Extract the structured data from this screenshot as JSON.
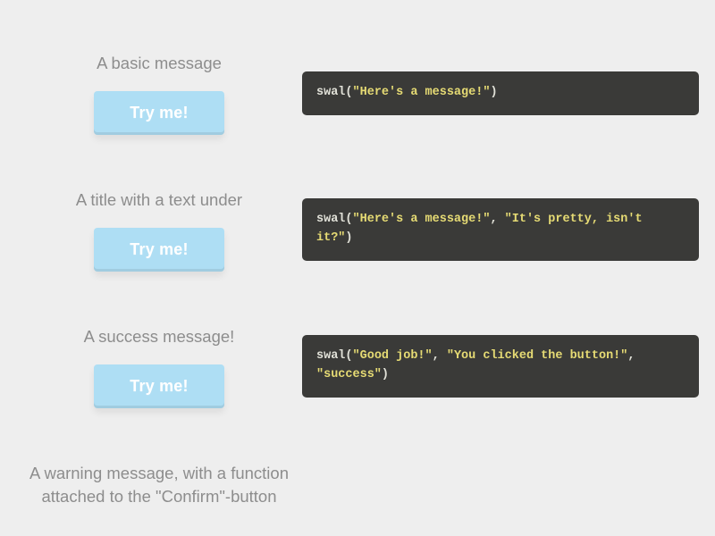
{
  "button_label": "Try me!",
  "examples": [
    {
      "title": "A basic message",
      "code": {
        "fn": "swal",
        "args": [
          "\"Here's a message!\""
        ]
      }
    },
    {
      "title": "A title with a text under",
      "code": {
        "fn": "swal",
        "args": [
          "\"Here's a message!\"",
          "\"It's pretty, isn't it?\""
        ]
      }
    },
    {
      "title": "A success message!",
      "code": {
        "fn": "swal",
        "args": [
          "\"Good job!\"",
          "\"You clicked the button!\"",
          "\"success\""
        ]
      }
    },
    {
      "title": "A warning message, with a function attached to the \"Confirm\"-button",
      "code": null
    }
  ]
}
